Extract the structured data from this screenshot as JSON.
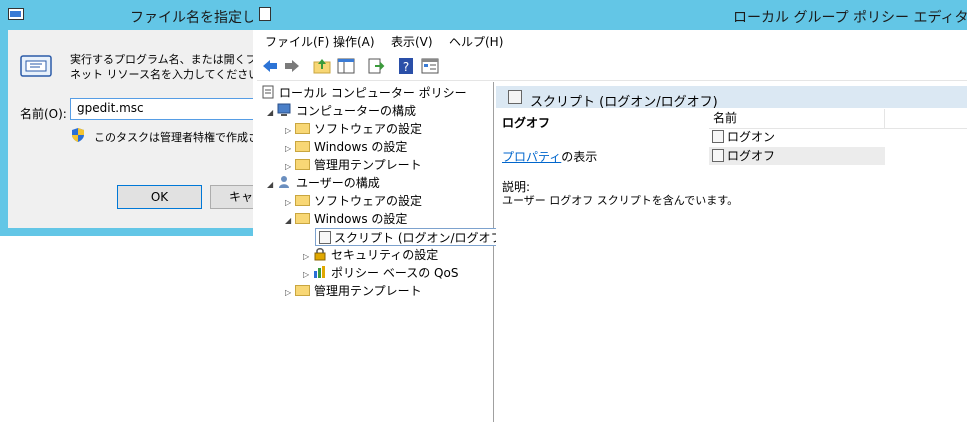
{
  "run_dialog": {
    "title": "ファイル名を指定して",
    "description_line1": "実行するプログラム名、または開くフォル",
    "description_line2": "ネット リソース名を入力してください。",
    "name_label": "名前(O):",
    "input_value": "gpedit.msc",
    "admin_note": "このタスクは管理者特権で作成さ",
    "ok_label": "OK",
    "cancel_label": "キャ"
  },
  "gpe": {
    "title": "ローカル グループ ポリシー エディター",
    "menu": [
      "ファイル(F)",
      "操作(A)",
      "表示(V)",
      "ヘルプ(H)"
    ],
    "tree": {
      "root": "ローカル コンピューター ポリシー",
      "computer_config": "コンピューターの構成",
      "computer_software": "ソフトウェアの設定",
      "computer_windows": "Windows の設定",
      "computer_admin": "管理用テンプレート",
      "user_config": "ユーザーの構成",
      "user_software": "ソフトウェアの設定",
      "user_windows": "Windows の設定",
      "scripts": "スクリプト (ログオン/ログオフ)",
      "security": "セキュリティの設定",
      "qos": "ポリシー ベースの QoS",
      "user_admin": "管理用テンプレート"
    },
    "right": {
      "header_title": "スクリプト (ログオン/ログオフ)",
      "section_title": "ログオフ",
      "properties_link": "プロパティ",
      "properties_suffix": "の表示",
      "desc_label": "説明:",
      "desc_text": "ユーザー ログオフ スクリプトを含んでいます。",
      "column_name": "名前",
      "items": [
        "ログオン",
        "ログオフ"
      ]
    }
  }
}
